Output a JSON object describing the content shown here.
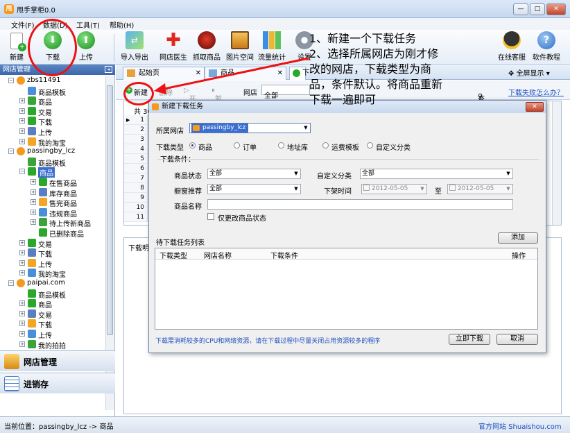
{
  "window": {
    "title": "甩手掌柜0.0",
    "min": "—",
    "max": "□",
    "close": "✕"
  },
  "menu": [
    "文件(F)",
    "数据(D)",
    "工具(T)",
    "帮助(H)"
  ],
  "toolbar": {
    "new": "新建",
    "download": "下载",
    "upload": "上传",
    "import_export": "导入导出",
    "shop_doctor": "网店医生",
    "crawl": "抓取商品",
    "image_space": "图片空间",
    "traffic": "流量统计",
    "settings": "设置",
    "support": "在线客服",
    "tutorial": "软件教程"
  },
  "left_panel": {
    "title": "网店管理",
    "tree": [
      {
        "label": "zbs11491",
        "level": 0,
        "box": "⊟"
      },
      {
        "label": "商品模板",
        "level": 1
      },
      {
        "label": "商品",
        "level": 1,
        "box": "⊞"
      },
      {
        "label": "交易",
        "level": 1,
        "box": "⊞"
      },
      {
        "label": "下载",
        "level": 1,
        "box": "⊞"
      },
      {
        "label": "上传",
        "level": 1,
        "box": "⊞"
      },
      {
        "label": "我的淘宝",
        "level": 1,
        "box": "⊞"
      },
      {
        "label": "passingby_lcz",
        "level": 0,
        "box": "⊟"
      },
      {
        "label": "商品模板",
        "level": 1
      },
      {
        "label": "商品",
        "level": 1,
        "box": "⊟",
        "selected": true
      },
      {
        "label": "在售商品",
        "level": 2,
        "box": "⊞"
      },
      {
        "label": "库存商品",
        "level": 2,
        "box": "⊞"
      },
      {
        "label": "售完商品",
        "level": 2,
        "box": "⊞"
      },
      {
        "label": "违规商品",
        "level": 2,
        "box": "⊞"
      },
      {
        "label": "待上传新商品",
        "level": 2,
        "box": "⊞"
      },
      {
        "label": "已删除商品",
        "level": 2
      },
      {
        "label": "交易",
        "level": 1,
        "box": "⊞"
      },
      {
        "label": "下载",
        "level": 1,
        "box": "⊞"
      },
      {
        "label": "上传",
        "level": 1,
        "box": "⊞"
      },
      {
        "label": "我的淘宝",
        "level": 1,
        "box": "⊞"
      },
      {
        "label": "paipai.com",
        "level": 0,
        "box": "⊟"
      },
      {
        "label": "商品模板",
        "level": 1
      },
      {
        "label": "商品",
        "level": 1,
        "box": "⊞"
      },
      {
        "label": "交易",
        "level": 1,
        "box": "⊞"
      },
      {
        "label": "下载",
        "level": 1,
        "box": "⊞"
      },
      {
        "label": "上传",
        "level": 1,
        "box": "⊞"
      },
      {
        "label": "我的拍拍",
        "level": 1,
        "box": "⊞"
      }
    ],
    "nav_shop": "网店管理",
    "nav_stock": "进销存"
  },
  "tabs": [
    {
      "label": "起始页"
    },
    {
      "label": "商品"
    },
    {
      "label": "下"
    }
  ],
  "fullscreen": "全屏显示",
  "subtoolbar": {
    "new": "新建",
    "delete": "删除",
    "start": "开始",
    "pause": "暂停",
    "shop_label": "网店",
    "shop_value": "全部",
    "query": "查询",
    "fail_link": "下载失败怎么办？"
  },
  "grid": {
    "count": "共 30",
    "rows": [
      "1",
      "2",
      "3",
      "4",
      "5",
      "6",
      "7",
      "8",
      "9",
      "10",
      "11"
    ],
    "bottom_label": "下载明"
  },
  "dialog": {
    "title": "新建下载任务",
    "shop_label": "所属网店",
    "shop_value": "passingby_lcz",
    "type_label": "下载类型",
    "types": [
      "商品",
      "订单",
      "地址库",
      "运费模板",
      "自定义分类"
    ],
    "conditions_label": "下载条件：",
    "status_label": "商品状态",
    "status_value": "全部",
    "custom_cat_label": "自定义分类",
    "custom_cat_value": "全部",
    "window_label": "橱窗推荐",
    "window_value": "全部",
    "offtime_label": "下架时间",
    "date_from": "2012-05-05",
    "to": "至",
    "date_to": "2012-05-05",
    "name_label": "商品名称",
    "name_value": "",
    "only_changed": "仅更改商品状态",
    "pending_label": "待下载任务列表",
    "add": "添加",
    "cols": [
      "下载类型",
      "网店名称",
      "下载条件",
      "操作"
    ],
    "note": "下载需消耗较多的CPU和网络资源，请在下载过程中尽量关闭占用资源较多的程序",
    "download_now": "立即下载",
    "cancel": "取消"
  },
  "annotation": {
    "line1": "1、新建一个下载任务",
    "line2": "2、选择所属网店为刚才修",
    "line3": "改的网店，下载类型为商",
    "line4": "品，条件默认。将商品重新",
    "line5": "下载一遍即可"
  },
  "status": {
    "location": "当前位置：passingby_lcz -> 商品",
    "site": "官方网站 Shuaishou.com"
  },
  "colors": {
    "accent": "#3a6fd0",
    "annotation": "#e11111",
    "link": "#1f4fbf"
  }
}
